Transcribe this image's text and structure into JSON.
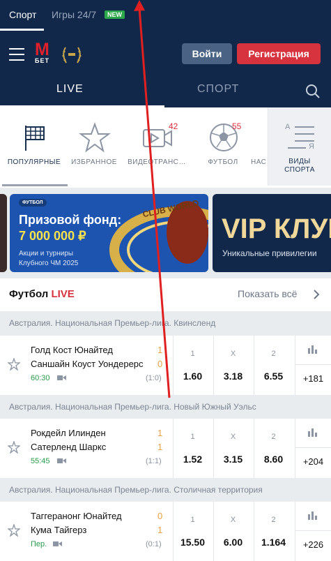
{
  "topbar": {
    "tab_sport": "Спорт",
    "tab_games": "Игры 24/7",
    "new_badge": "NEW"
  },
  "header": {
    "logo_m": "М",
    "logo_bet": "БЕТ",
    "login": "Войти",
    "register": "Регистрация",
    "tab_live": "LIVE",
    "tab_sport": "СПОРТ"
  },
  "categories": [
    {
      "label": "ПОПУЛЯРНЫЕ",
      "icon": "flag-icon",
      "active": true
    },
    {
      "label": "ИЗБРАННОЕ",
      "icon": "star-icon"
    },
    {
      "label": "ВИДЕОТРАНС…",
      "icon": "video-icon",
      "count": "42"
    },
    {
      "label": "ФУТБОЛ",
      "icon": "football-icon",
      "count": "55"
    },
    {
      "label": "НАС Т",
      "icon": "partial-icon"
    }
  ],
  "sports_kinds": {
    "line1": "ВИДЫ",
    "line2": "СПОРТА",
    "letter_a": "А",
    "letter_ya": "Я"
  },
  "banners": {
    "b1_tag": "ФУТБОЛ",
    "b1_title": "Призовой фонд:",
    "b1_amount": "7 000 000 ₽",
    "b1_sub1": "Акции и турниры",
    "b1_sub2": "Клубного ЧМ 2025",
    "b1_cup_text": "CLUB WORLD",
    "b2_title": "VIP КЛУБ",
    "b2_sub": "Уникальные привилегии"
  },
  "section": {
    "title": "Футбол",
    "title_live": "LIVE",
    "show_all": "Показать всё"
  },
  "matches": [
    {
      "league": "Австралия. Национальная Премьер-лига. Квинсленд",
      "team1": "Голд Кост Юнайтед",
      "team2": "Саншайн Коуст Уондерерс",
      "score1": "1",
      "score2": "0",
      "time": "60:30",
      "half": "(1:0)",
      "k1": "1",
      "kx": "X",
      "k2": "2",
      "o1": "1.60",
      "ox": "3.18",
      "o2": "6.55",
      "more": "+181"
    },
    {
      "league": "Австралия. Национальная Премьер-лига. Новый Южный Уэльс",
      "team1": "Рокдейл Илинден",
      "team2": "Сатерленд Шаркс",
      "score1": "1",
      "score2": "1",
      "time": "55:45",
      "half": "(1:1)",
      "k1": "1",
      "kx": "X",
      "k2": "2",
      "o1": "1.52",
      "ox": "3.15",
      "o2": "8.60",
      "more": "+204"
    },
    {
      "league": "Австралия. Национальная Премьер-лига. Столичная территория",
      "team1": "Таггеранонг Юнайтед",
      "team2": "Кума Тайгерз",
      "score1": "0",
      "score2": "1",
      "time": "Пер.",
      "half": "(0:1)",
      "k1": "1",
      "kx": "X",
      "k2": "2",
      "o1": "15.50",
      "ox": "6.00",
      "o2": "1.164",
      "more": "+226"
    }
  ],
  "colors": {
    "navy": "#12284a",
    "red": "#d7333f",
    "live_green": "#2a9c4a",
    "score_orange": "#e8a040"
  }
}
